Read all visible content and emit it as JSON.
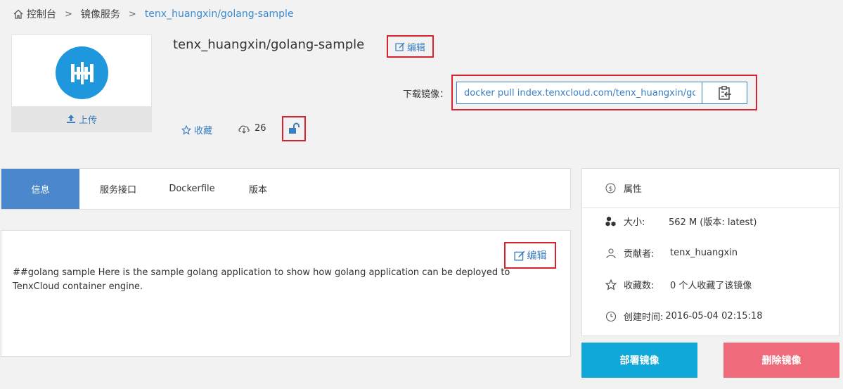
{
  "breadcrumb": {
    "home": "控制台",
    "section": "镜像服务",
    "current": "tenx_huangxin/golang-sample"
  },
  "image": {
    "title": "tenx_huangxin/golang-sample",
    "edit_label": "编辑",
    "upload_label": "上传"
  },
  "pull": {
    "label": "下载镜像：",
    "command": "docker pull index.tenxcloud.com/tenx_huangxin/golang-sample"
  },
  "stats": {
    "favorite_label": "收藏",
    "download_count": "26"
  },
  "tabs": [
    {
      "label": "信息"
    },
    {
      "label": "服务接口"
    },
    {
      "label": "Dockerfile"
    },
    {
      "label": "版本"
    }
  ],
  "description": {
    "edit_label": "编辑",
    "text": "##golang sample Here is the sample golang application to show how golang application can be deployed to TenxCloud container engine."
  },
  "properties": {
    "title": "属性",
    "size_label": "大小:",
    "size_value": "562 M (版本: latest)",
    "contributor_label": "贡献者:",
    "contributor_value": "tenx_huangxin",
    "favorites_label": "收藏数:",
    "favorites_value": "0 个人收藏了该镜像",
    "created_label": "创建时间:",
    "created_value": "2016-05-04 02:15:18"
  },
  "actions": {
    "deploy": "部署镜像",
    "delete": "删除镜像"
  },
  "colors": {
    "accent": "#3a7ec2",
    "tab_active": "#4a87cc",
    "deploy": "#0fa8d9",
    "delete": "#ef6b7b",
    "highlight": "#d9232f"
  }
}
